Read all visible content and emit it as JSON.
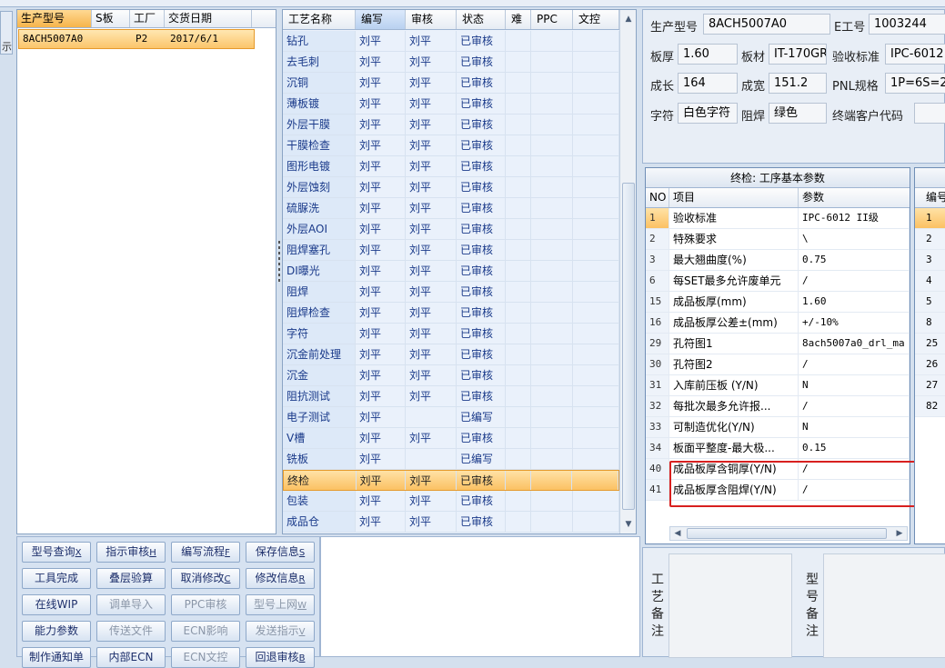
{
  "left_nub": {
    "label": "示"
  },
  "orders": {
    "columns": [
      "生产型号",
      "S板",
      "工厂",
      "交货日期"
    ],
    "rows": [
      {
        "model": "8ACH5007A0",
        "s_board": "",
        "factory": "P2",
        "delivery": "2017/6/1"
      }
    ]
  },
  "process": {
    "columns": [
      "工艺名称",
      "编写",
      "审核",
      "状态",
      "难",
      "PPC",
      "文控"
    ],
    "rows": [
      {
        "name": "钻孔",
        "writer": "刘平",
        "reviewer": "刘平",
        "status": "已审核"
      },
      {
        "name": "去毛刺",
        "writer": "刘平",
        "reviewer": "刘平",
        "status": "已审核"
      },
      {
        "name": "沉铜",
        "writer": "刘平",
        "reviewer": "刘平",
        "status": "已审核"
      },
      {
        "name": "薄板镀",
        "writer": "刘平",
        "reviewer": "刘平",
        "status": "已审核"
      },
      {
        "name": "外层干膜",
        "writer": "刘平",
        "reviewer": "刘平",
        "status": "已审核"
      },
      {
        "name": "干膜检查",
        "writer": "刘平",
        "reviewer": "刘平",
        "status": "已审核"
      },
      {
        "name": "图形电镀",
        "writer": "刘平",
        "reviewer": "刘平",
        "status": "已审核"
      },
      {
        "name": "外层蚀刻",
        "writer": "刘平",
        "reviewer": "刘平",
        "status": "已审核"
      },
      {
        "name": "硫脲洗",
        "writer": "刘平",
        "reviewer": "刘平",
        "status": "已审核"
      },
      {
        "name": "外层AOI",
        "writer": "刘平",
        "reviewer": "刘平",
        "status": "已审核"
      },
      {
        "name": "阻焊塞孔",
        "writer": "刘平",
        "reviewer": "刘平",
        "status": "已审核"
      },
      {
        "name": "DI曝光",
        "writer": "刘平",
        "reviewer": "刘平",
        "status": "已审核"
      },
      {
        "name": "阻焊",
        "writer": "刘平",
        "reviewer": "刘平",
        "status": "已审核"
      },
      {
        "name": "阻焊检查",
        "writer": "刘平",
        "reviewer": "刘平",
        "status": "已审核"
      },
      {
        "name": "字符",
        "writer": "刘平",
        "reviewer": "刘平",
        "status": "已审核"
      },
      {
        "name": "沉金前处理",
        "writer": "刘平",
        "reviewer": "刘平",
        "status": "已审核"
      },
      {
        "name": "沉金",
        "writer": "刘平",
        "reviewer": "刘平",
        "status": "已审核"
      },
      {
        "name": "阻抗测试",
        "writer": "刘平",
        "reviewer": "刘平",
        "status": "已审核"
      },
      {
        "name": "电子测试",
        "writer": "刘平",
        "reviewer": "",
        "status": "已编写"
      },
      {
        "name": "V槽",
        "writer": "刘平",
        "reviewer": "刘平",
        "status": "已审核"
      },
      {
        "name": "铣板",
        "writer": "刘平",
        "reviewer": "",
        "status": "已编写"
      },
      {
        "name": "终检",
        "writer": "刘平",
        "reviewer": "刘平",
        "status": "已审核",
        "selected": true
      },
      {
        "name": "包装",
        "writer": "刘平",
        "reviewer": "刘平",
        "status": "已审核"
      },
      {
        "name": "成品仓",
        "writer": "刘平",
        "reviewer": "刘平",
        "status": "已审核"
      }
    ]
  },
  "buttons": [
    {
      "label": "型号查询",
      "key": "X",
      "enabled": true
    },
    {
      "label": "指示审核",
      "key": "H",
      "enabled": true
    },
    {
      "label": "编写流程",
      "key": "F",
      "enabled": true
    },
    {
      "label": "保存信息",
      "key": "S",
      "enabled": true
    },
    {
      "label": "工具完成",
      "key": "",
      "enabled": true
    },
    {
      "label": "叠层验算",
      "key": "",
      "enabled": true
    },
    {
      "label": "取消修改",
      "key": "C",
      "enabled": true
    },
    {
      "label": "修改信息",
      "key": "R",
      "enabled": true
    },
    {
      "label": "在线WIP",
      "key": "",
      "enabled": true
    },
    {
      "label": "调单导入",
      "key": "",
      "enabled": false
    },
    {
      "label": "PPC审核",
      "key": "",
      "enabled": false
    },
    {
      "label": "型号上网",
      "key": "W",
      "enabled": false
    },
    {
      "label": "能力参数",
      "key": "",
      "enabled": true
    },
    {
      "label": "传送文件",
      "key": "",
      "enabled": false
    },
    {
      "label": "ECN影响",
      "key": "",
      "enabled": false
    },
    {
      "label": "发送指示",
      "key": "V",
      "enabled": false
    },
    {
      "label": "制作通知单",
      "key": "",
      "enabled": true
    },
    {
      "label": "内部ECN",
      "key": "",
      "enabled": true
    },
    {
      "label": "ECN文控",
      "key": "",
      "enabled": false
    },
    {
      "label": "回退审核",
      "key": "B",
      "enabled": true
    }
  ],
  "info": {
    "model_label": "生产型号",
    "model_value": "8ACH5007A0",
    "eno_label": "E工号",
    "eno_value": "1003244",
    "thickness_label": "板厚",
    "thickness_value": "1.60",
    "material_label": "板材",
    "material_value": "IT-170GR",
    "standard_label": "验收标准",
    "standard_value": "IPC-6012",
    "length_label": "成长",
    "length_value": "164",
    "width_label": "成宽",
    "width_value": "151.2",
    "pnl_label": "PNL规格",
    "pnl_value": "1P=6S=2",
    "char_label": "字符",
    "char_value": "白色字符",
    "mask_label": "阻焊",
    "mask_value": "绿色",
    "customer_label": "终端客户代码",
    "customer_value": ""
  },
  "params": {
    "title": "终检: 工序基本参数",
    "columns": [
      "NO",
      "项目",
      "参数"
    ],
    "rows": [
      {
        "no": "1",
        "item": "验收标准",
        "value": "IPC-6012 II级",
        "selected": true
      },
      {
        "no": "2",
        "item": "特殊要求",
        "value": "\\"
      },
      {
        "no": "3",
        "item": "最大翘曲度(%)",
        "value": "0.75"
      },
      {
        "no": "6",
        "item": "每SET最多允许废单元",
        "value": "/"
      },
      {
        "no": "15",
        "item": "成品板厚(mm)",
        "value": "1.60"
      },
      {
        "no": "16",
        "item": "成品板厚公差±(mm)",
        "value": "+/-10%"
      },
      {
        "no": "29",
        "item": "孔符图1",
        "value": "8ach5007a0_drl_ma"
      },
      {
        "no": "30",
        "item": "孔符图2",
        "value": "/"
      },
      {
        "no": "31",
        "item": "入库前压板 (Y/N)",
        "value": "N"
      },
      {
        "no": "32",
        "item": "每批次最多允许报...",
        "value": "/"
      },
      {
        "no": "33",
        "item": "可制造优化(Y/N)",
        "value": "N"
      },
      {
        "no": "34",
        "item": "板面平整度-最大极...",
        "value": "0.15"
      },
      {
        "no": "40",
        "item": "成品板厚含铜厚(Y/N)",
        "value": "/"
      },
      {
        "no": "41",
        "item": "成品板厚含阻焊(Y/N)",
        "value": "/"
      }
    ]
  },
  "params2": {
    "header": "编号",
    "rows": [
      "1",
      "2",
      "3",
      "4",
      "5",
      "8",
      "25",
      "26",
      "27",
      "82"
    ]
  },
  "notes": {
    "process_note_label": "工艺备注",
    "model_note_label": "型号备注"
  },
  "colors": {
    "selection": "#fbc163",
    "highlight_box": "#d8201f",
    "text_blue": "#1a3a8a"
  }
}
